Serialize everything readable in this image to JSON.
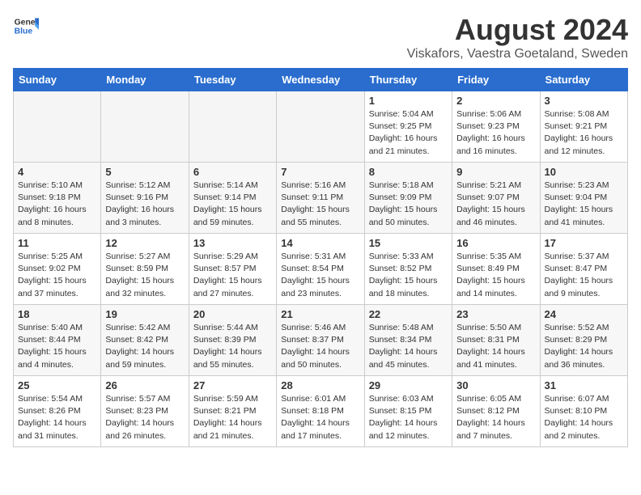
{
  "header": {
    "logo_general": "General",
    "logo_blue": "Blue",
    "title": "August 2024",
    "subtitle": "Viskafors, Vaestra Goetaland, Sweden"
  },
  "weekdays": [
    "Sunday",
    "Monday",
    "Tuesday",
    "Wednesday",
    "Thursday",
    "Friday",
    "Saturday"
  ],
  "weeks": [
    [
      {
        "day": "",
        "empty": true
      },
      {
        "day": "",
        "empty": true
      },
      {
        "day": "",
        "empty": true
      },
      {
        "day": "",
        "empty": true
      },
      {
        "day": "1",
        "info": "Sunrise: 5:04 AM\nSunset: 9:25 PM\nDaylight: 16 hours\nand 21 minutes."
      },
      {
        "day": "2",
        "info": "Sunrise: 5:06 AM\nSunset: 9:23 PM\nDaylight: 16 hours\nand 16 minutes."
      },
      {
        "day": "3",
        "info": "Sunrise: 5:08 AM\nSunset: 9:21 PM\nDaylight: 16 hours\nand 12 minutes."
      }
    ],
    [
      {
        "day": "4",
        "info": "Sunrise: 5:10 AM\nSunset: 9:18 PM\nDaylight: 16 hours\nand 8 minutes."
      },
      {
        "day": "5",
        "info": "Sunrise: 5:12 AM\nSunset: 9:16 PM\nDaylight: 16 hours\nand 3 minutes."
      },
      {
        "day": "6",
        "info": "Sunrise: 5:14 AM\nSunset: 9:14 PM\nDaylight: 15 hours\nand 59 minutes."
      },
      {
        "day": "7",
        "info": "Sunrise: 5:16 AM\nSunset: 9:11 PM\nDaylight: 15 hours\nand 55 minutes."
      },
      {
        "day": "8",
        "info": "Sunrise: 5:18 AM\nSunset: 9:09 PM\nDaylight: 15 hours\nand 50 minutes."
      },
      {
        "day": "9",
        "info": "Sunrise: 5:21 AM\nSunset: 9:07 PM\nDaylight: 15 hours\nand 46 minutes."
      },
      {
        "day": "10",
        "info": "Sunrise: 5:23 AM\nSunset: 9:04 PM\nDaylight: 15 hours\nand 41 minutes."
      }
    ],
    [
      {
        "day": "11",
        "info": "Sunrise: 5:25 AM\nSunset: 9:02 PM\nDaylight: 15 hours\nand 37 minutes."
      },
      {
        "day": "12",
        "info": "Sunrise: 5:27 AM\nSunset: 8:59 PM\nDaylight: 15 hours\nand 32 minutes."
      },
      {
        "day": "13",
        "info": "Sunrise: 5:29 AM\nSunset: 8:57 PM\nDaylight: 15 hours\nand 27 minutes."
      },
      {
        "day": "14",
        "info": "Sunrise: 5:31 AM\nSunset: 8:54 PM\nDaylight: 15 hours\nand 23 minutes."
      },
      {
        "day": "15",
        "info": "Sunrise: 5:33 AM\nSunset: 8:52 PM\nDaylight: 15 hours\nand 18 minutes."
      },
      {
        "day": "16",
        "info": "Sunrise: 5:35 AM\nSunset: 8:49 PM\nDaylight: 15 hours\nand 14 minutes."
      },
      {
        "day": "17",
        "info": "Sunrise: 5:37 AM\nSunset: 8:47 PM\nDaylight: 15 hours\nand 9 minutes."
      }
    ],
    [
      {
        "day": "18",
        "info": "Sunrise: 5:40 AM\nSunset: 8:44 PM\nDaylight: 15 hours\nand 4 minutes."
      },
      {
        "day": "19",
        "info": "Sunrise: 5:42 AM\nSunset: 8:42 PM\nDaylight: 14 hours\nand 59 minutes."
      },
      {
        "day": "20",
        "info": "Sunrise: 5:44 AM\nSunset: 8:39 PM\nDaylight: 14 hours\nand 55 minutes."
      },
      {
        "day": "21",
        "info": "Sunrise: 5:46 AM\nSunset: 8:37 PM\nDaylight: 14 hours\nand 50 minutes."
      },
      {
        "day": "22",
        "info": "Sunrise: 5:48 AM\nSunset: 8:34 PM\nDaylight: 14 hours\nand 45 minutes."
      },
      {
        "day": "23",
        "info": "Sunrise: 5:50 AM\nSunset: 8:31 PM\nDaylight: 14 hours\nand 41 minutes."
      },
      {
        "day": "24",
        "info": "Sunrise: 5:52 AM\nSunset: 8:29 PM\nDaylight: 14 hours\nand 36 minutes."
      }
    ],
    [
      {
        "day": "25",
        "info": "Sunrise: 5:54 AM\nSunset: 8:26 PM\nDaylight: 14 hours\nand 31 minutes."
      },
      {
        "day": "26",
        "info": "Sunrise: 5:57 AM\nSunset: 8:23 PM\nDaylight: 14 hours\nand 26 minutes."
      },
      {
        "day": "27",
        "info": "Sunrise: 5:59 AM\nSunset: 8:21 PM\nDaylight: 14 hours\nand 21 minutes."
      },
      {
        "day": "28",
        "info": "Sunrise: 6:01 AM\nSunset: 8:18 PM\nDaylight: 14 hours\nand 17 minutes."
      },
      {
        "day": "29",
        "info": "Sunrise: 6:03 AM\nSunset: 8:15 PM\nDaylight: 14 hours\nand 12 minutes."
      },
      {
        "day": "30",
        "info": "Sunrise: 6:05 AM\nSunset: 8:12 PM\nDaylight: 14 hours\nand 7 minutes."
      },
      {
        "day": "31",
        "info": "Sunrise: 6:07 AM\nSunset: 8:10 PM\nDaylight: 14 hours\nand 2 minutes."
      }
    ]
  ]
}
